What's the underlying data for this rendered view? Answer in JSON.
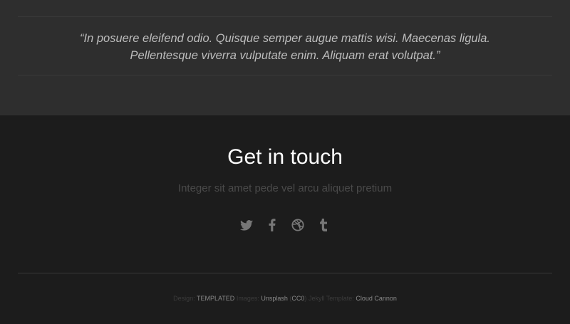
{
  "quote": {
    "line1": "“In posuere eleifend odio. Quisque semper augue mattis wisi. Maecenas ligula.",
    "line2": "Pellentesque viverra vulputate enim. Aliquam erat volutpat.”"
  },
  "contact": {
    "title": "Get in touch",
    "subtitle": "Integer sit amet pede vel arcu aliquet pretium"
  },
  "social": [
    "twitter-icon",
    "facebook-icon",
    "dribbble-icon",
    "tumblr-icon"
  ],
  "footer": {
    "design_label": "Design:",
    "design_link": "TEMPLATED",
    "images_label": "Images:",
    "images_link": "Unsplash",
    "open_paren": "(",
    "cc_link": "CC0",
    "close_paren": ")",
    "jekyll_label": "Jekyll Template:",
    "jekyll_link": "Cloud Cannon"
  }
}
